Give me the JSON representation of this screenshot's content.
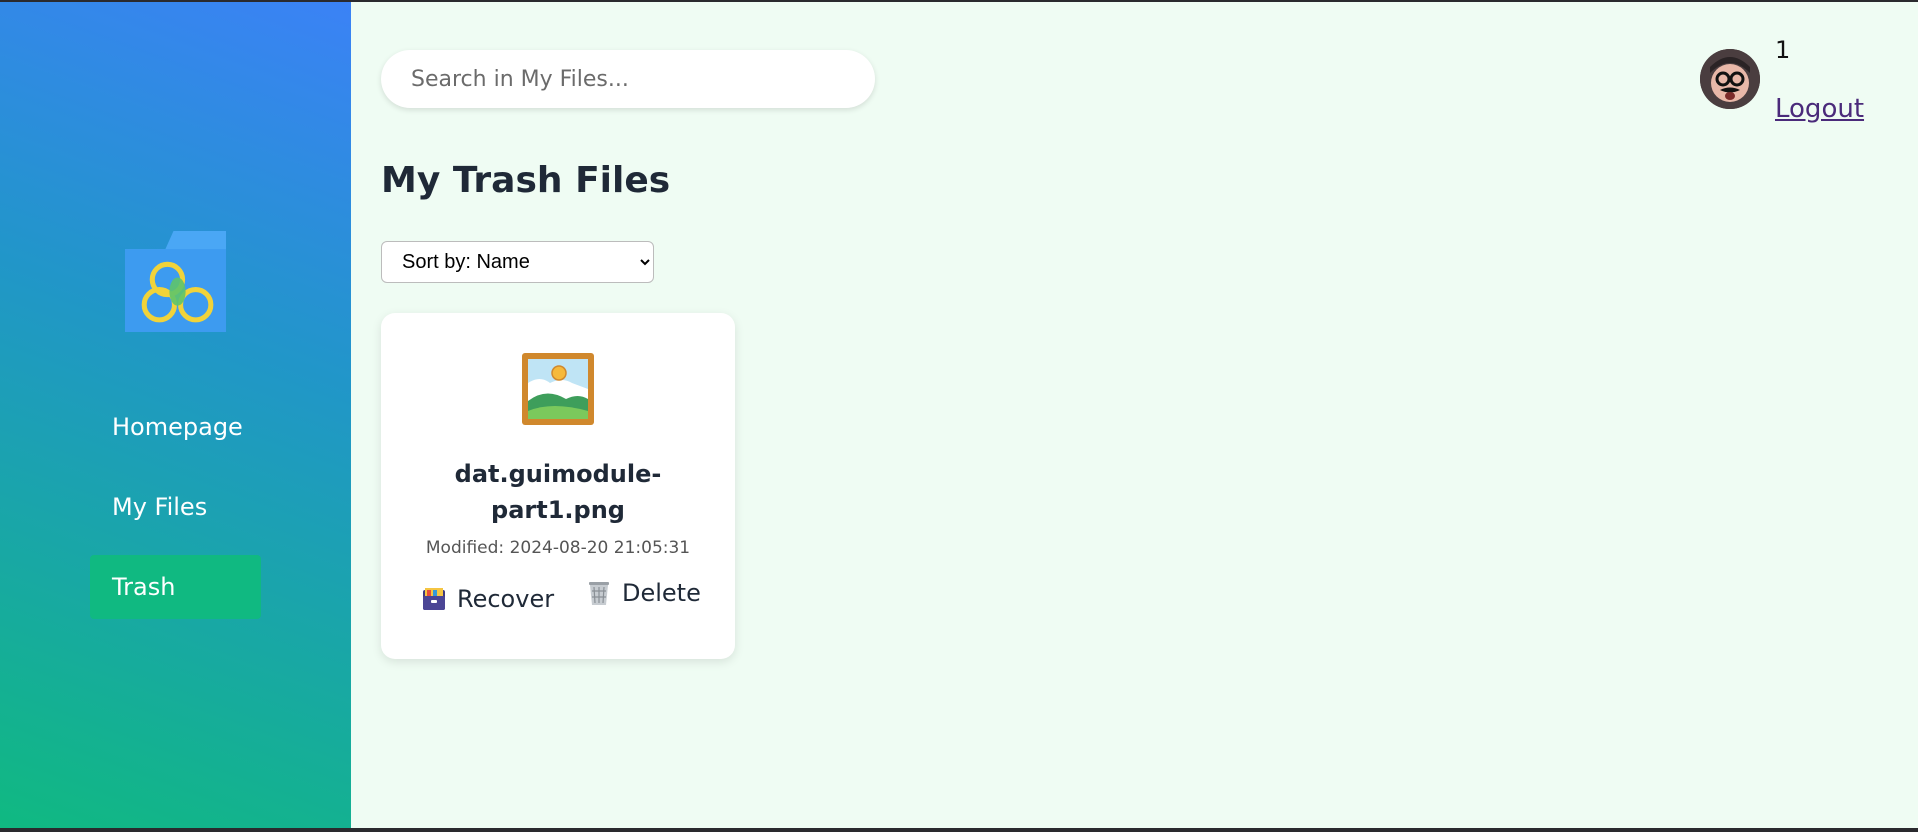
{
  "sidebar": {
    "logo_icon": "folder-logo-icon",
    "items": [
      {
        "label": "Homepage",
        "active": false
      },
      {
        "label": "My Files",
        "active": false
      },
      {
        "label": "Trash",
        "active": true
      }
    ],
    "gradient_colors": [
      "#3b82f6",
      "#10b981"
    ],
    "active_color": "#10b981"
  },
  "header": {
    "search_placeholder": "Search in My Files...",
    "search_value": "",
    "user_count": "1",
    "logout_label": "Logout",
    "avatar_icon": "user-avatar"
  },
  "main": {
    "title": "My Trash Files",
    "sort": {
      "selected": "Sort by: Name"
    },
    "files": [
      {
        "icon": "framed-picture-icon",
        "name": "dat.guimodule-part1.png",
        "modified_label": "Modified:",
        "modified_value": "2024-08-20 21:05:31",
        "actions": {
          "recover_label": "Recover",
          "recover_icon": "file-cabinet-icon",
          "delete_label": "Delete",
          "delete_icon": "wastebasket-icon"
        }
      }
    ]
  },
  "colors": {
    "background": "#effcf3",
    "text": "#1f2937"
  }
}
